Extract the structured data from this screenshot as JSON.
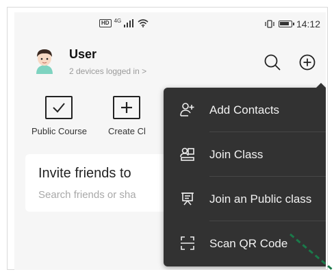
{
  "status_bar": {
    "hd": "HD",
    "network": "4G",
    "time": "14:12"
  },
  "header": {
    "username": "User",
    "devices": "2 devices logged in >"
  },
  "actions": [
    {
      "label": "Public Course",
      "icon": "checkbox-icon"
    },
    {
      "label": "Create Cl",
      "icon": "plus-icon"
    }
  ],
  "invite": {
    "title": "Invite friends to",
    "subtitle": "Search friends or sha"
  },
  "menu": {
    "items": [
      {
        "label": "Add Contacts",
        "icon": "add-contact-icon"
      },
      {
        "label": "Join Class",
        "icon": "join-class-icon"
      },
      {
        "label": "Join an Public class",
        "icon": "public-class-icon"
      },
      {
        "label": "Scan QR Code",
        "icon": "scan-icon"
      }
    ]
  },
  "colors": {
    "menu_bg": "#323232",
    "accent_line": "#1a7a4a"
  }
}
